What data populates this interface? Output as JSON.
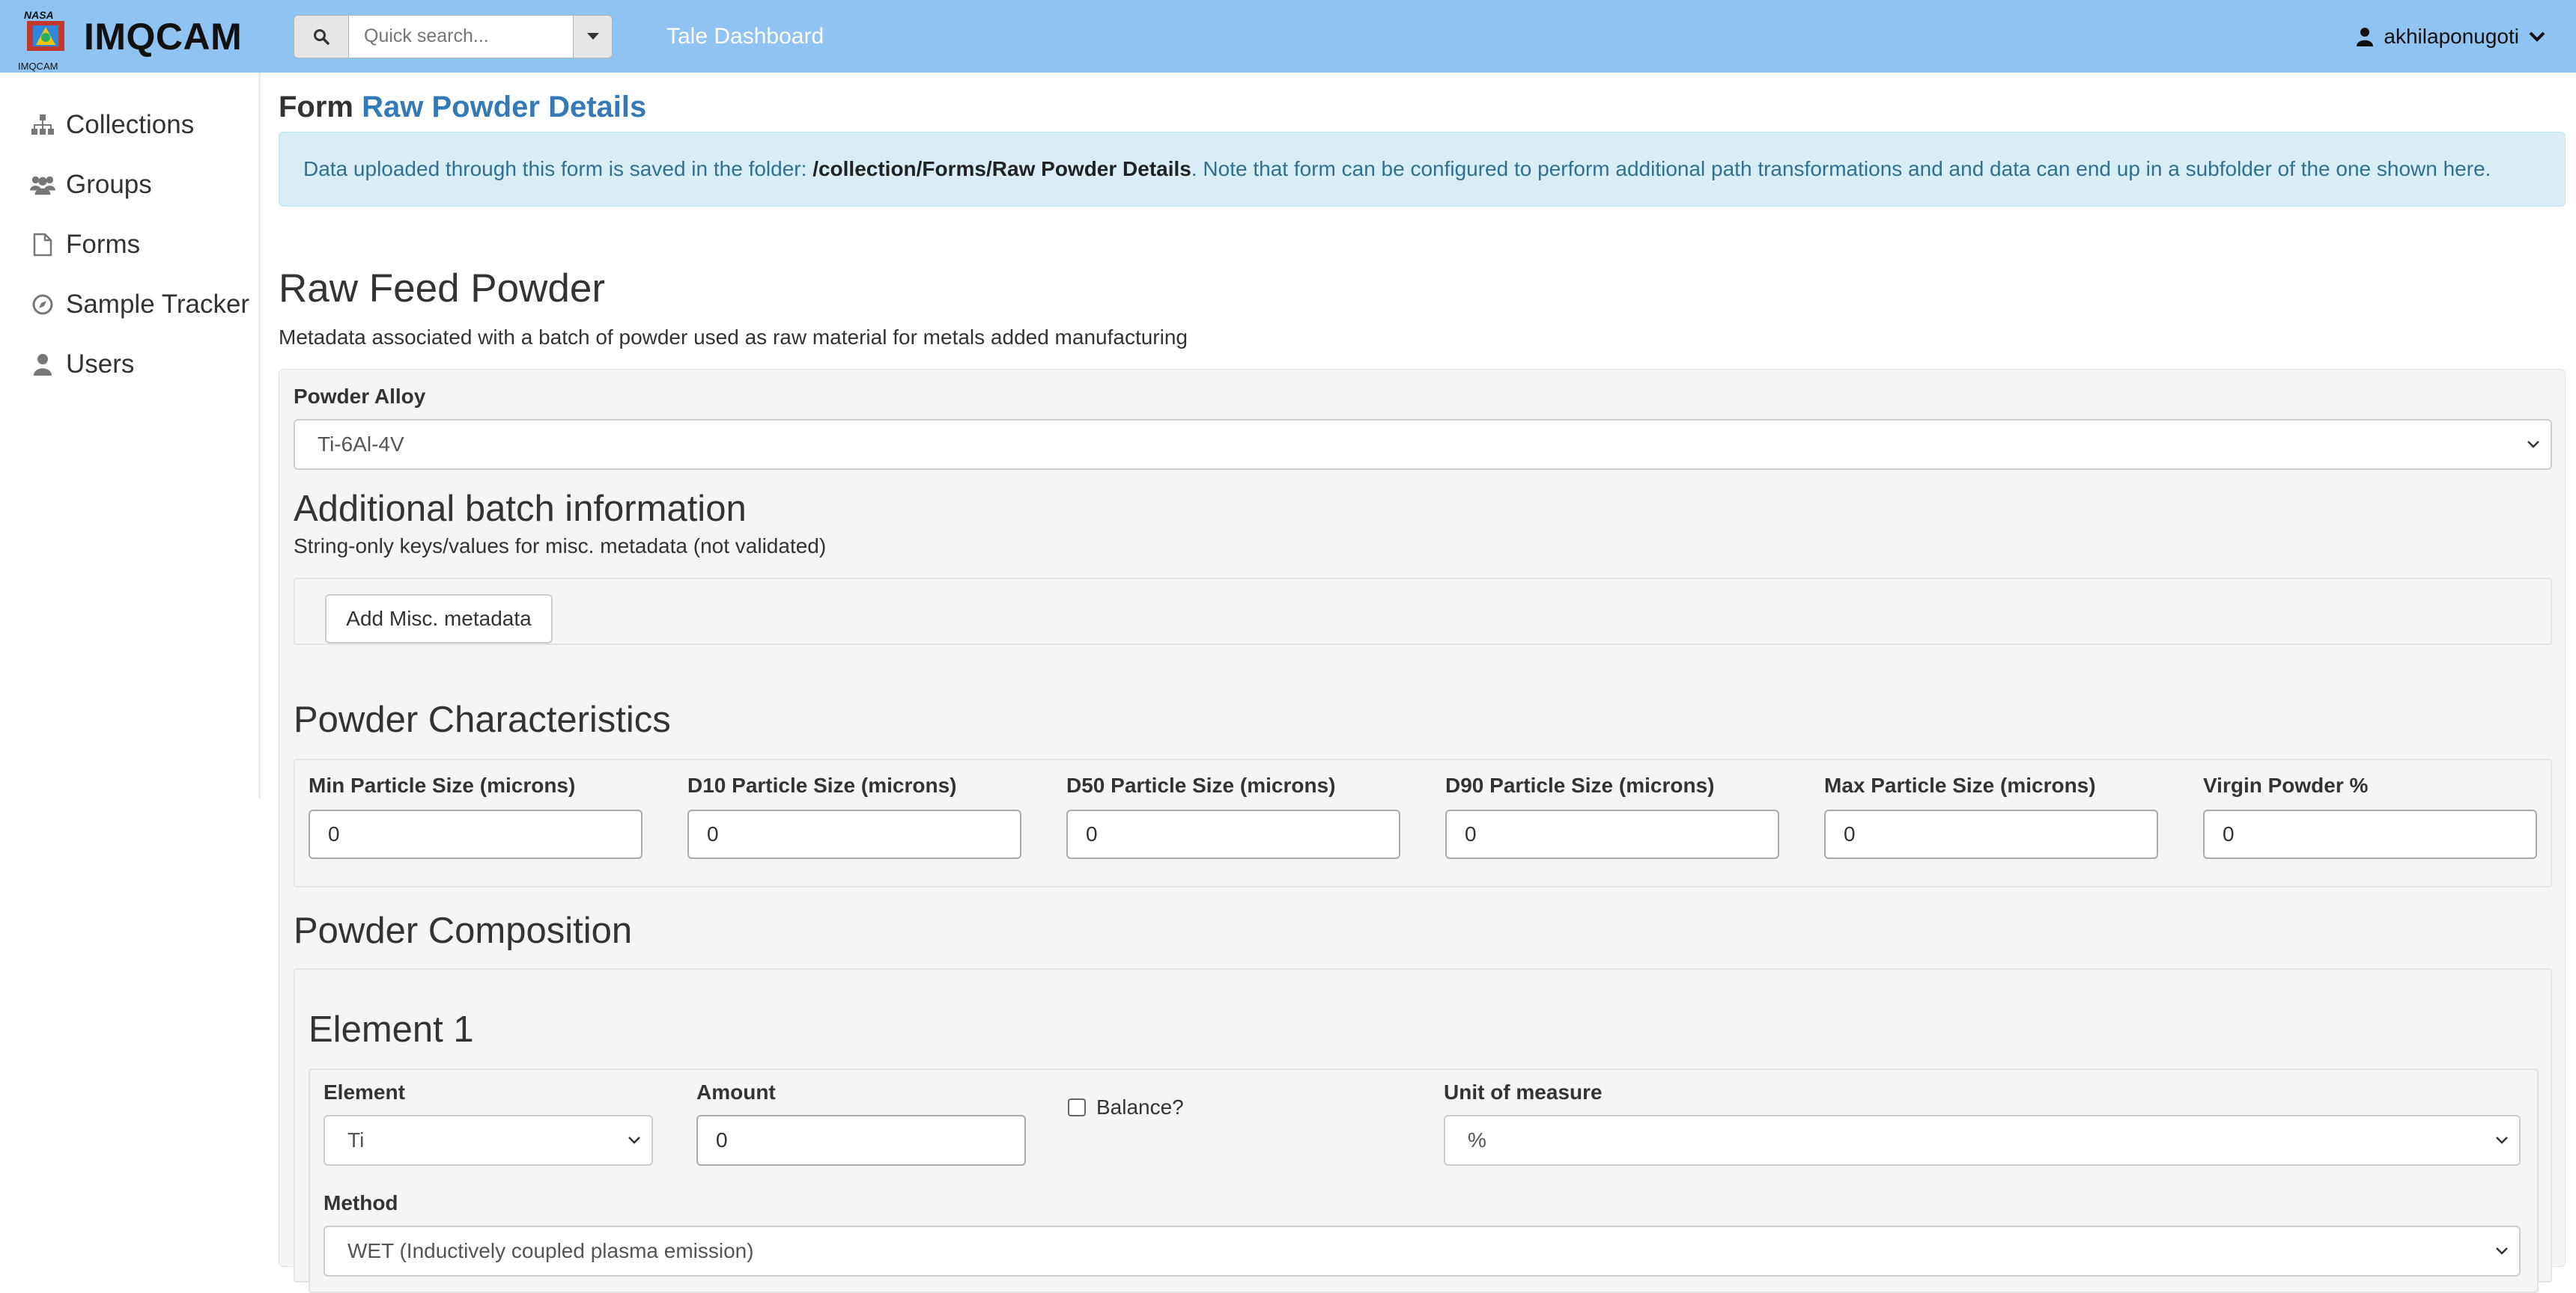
{
  "navbar": {
    "brand_name": "IMQCAM",
    "logo_top": "NASA",
    "logo_bottom": "IMQCAM",
    "search_placeholder": "Quick search...",
    "tale_dashboard": "Tale Dashboard",
    "user": "akhilaponugoti",
    "bg_color": "#8fc4f2"
  },
  "sidebar": {
    "items": [
      {
        "label": "Collections",
        "icon": "sitemap-icon"
      },
      {
        "label": "Groups",
        "icon": "users-icon"
      },
      {
        "label": "Forms",
        "icon": "file-icon"
      },
      {
        "label": "Sample Tracker",
        "icon": "compass-icon"
      },
      {
        "label": "Users",
        "icon": "user-icon"
      }
    ]
  },
  "page": {
    "title_prefix": "Form",
    "title_name": "Raw Powder Details",
    "alert_pre": "Data uploaded through this form is saved in the folder:",
    "alert_path": "/collection/Forms/Raw Powder Details",
    "alert_post": ". Note that form can be configured to perform additional path transformations and and data can end up in a subfolder of the one shown here.",
    "accent_color": "#337ab7",
    "alert_bg": "#d9edf7"
  },
  "form": {
    "section_title": "Raw Feed Powder",
    "section_desc": "Metadata associated with a batch of powder used as raw material for metals added manufacturing",
    "alloy_label": "Powder Alloy",
    "alloy_value": "Ti-6Al-4V",
    "additional": {
      "title": "Additional batch information",
      "desc": "String-only keys/values for misc. metadata (not validated)",
      "add_button": "Add Misc. metadata"
    },
    "characteristics": {
      "title": "Powder Characteristics",
      "fields": [
        {
          "label": "Min Particle Size (microns)",
          "value": "0"
        },
        {
          "label": "D10 Particle Size (microns)",
          "value": "0"
        },
        {
          "label": "D50 Particle Size (microns)",
          "value": "0"
        },
        {
          "label": "D90 Particle Size (microns)",
          "value": "0"
        },
        {
          "label": "Max Particle Size (microns)",
          "value": "0"
        },
        {
          "label": "Virgin Powder %",
          "value": "0"
        }
      ]
    },
    "composition": {
      "title": "Powder Composition",
      "element_title": "Element 1",
      "element_label": "Element",
      "element_value": "Ti",
      "amount_label": "Amount",
      "amount_value": "0",
      "balance_label": "Balance?",
      "unit_label": "Unit of measure",
      "unit_value": "%",
      "method_label": "Method",
      "method_value": "WET (Inductively coupled plasma emission)"
    }
  }
}
